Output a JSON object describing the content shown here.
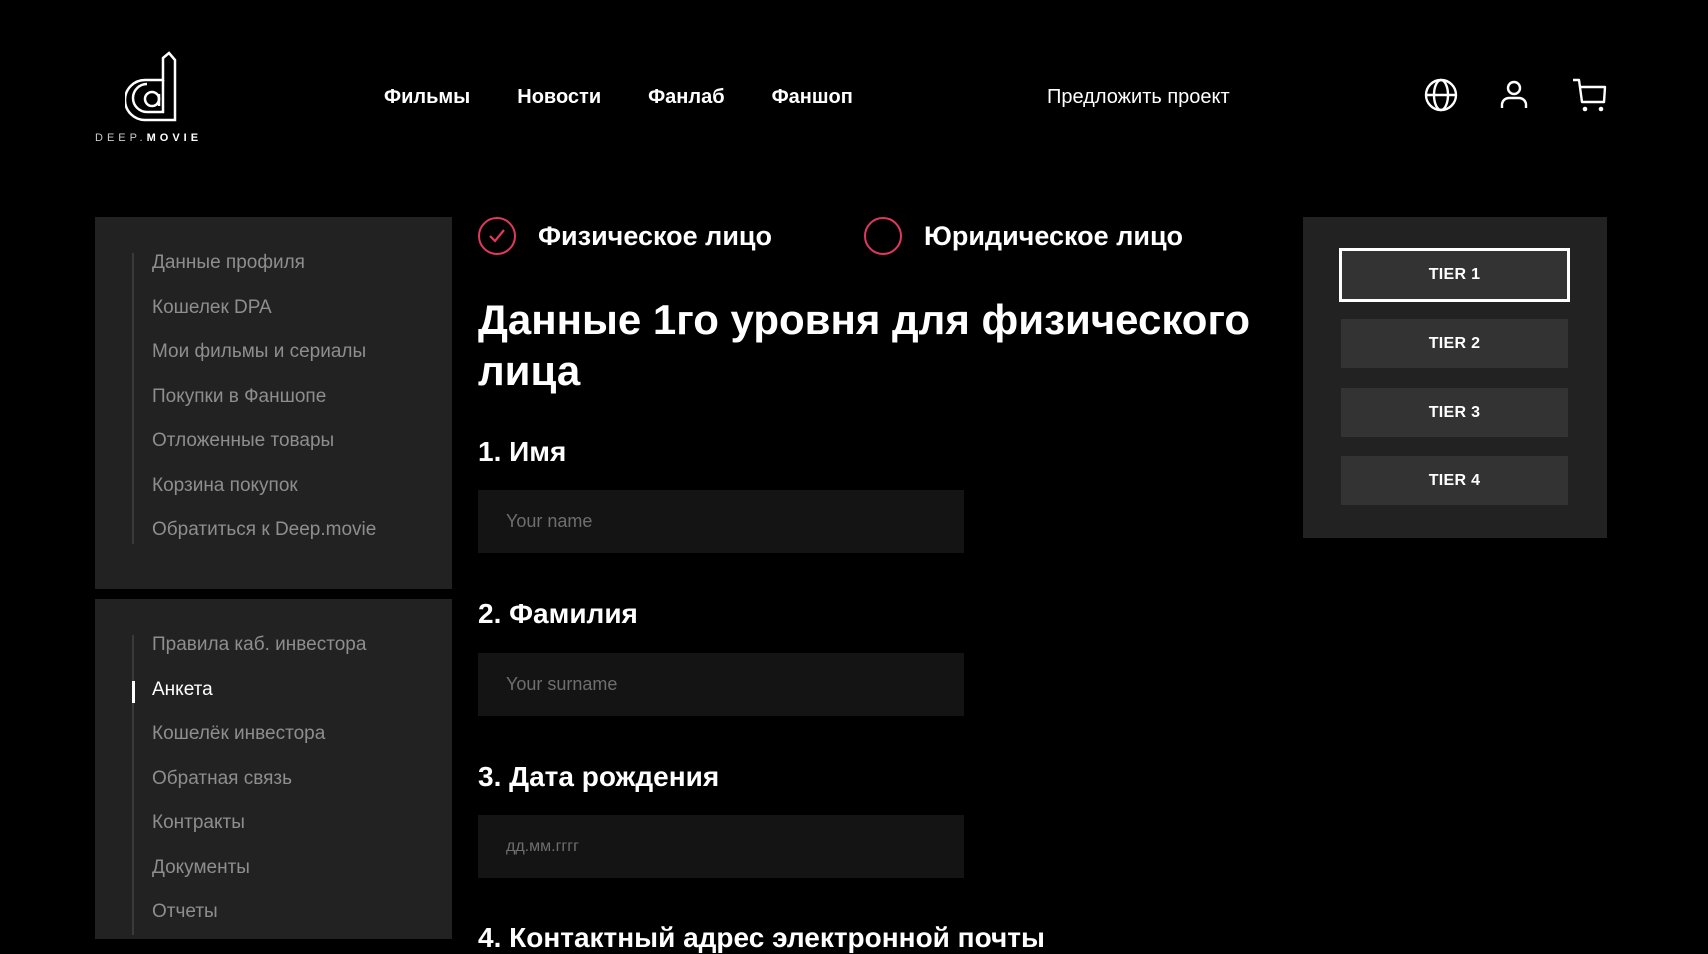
{
  "brand": {
    "name_light": "DEEP.",
    "name_bold": "MOVIE"
  },
  "nav": {
    "items": [
      "Фильмы",
      "Новости",
      "Фанлаб",
      "Фаншоп"
    ],
    "suggest_project": "Предложить проект"
  },
  "header_icons": [
    "globe-icon",
    "user-icon",
    "cart-icon"
  ],
  "sidebar": {
    "profile_menu": [
      "Данные профиля",
      "Кошелек DPA",
      "Мои фильмы и сериалы",
      "Покупки в Фаншопе",
      "Отложенные товары",
      "Корзина покупок",
      "Обратиться к Deep.movie"
    ],
    "investor_menu": [
      "Правила каб. инвестора",
      "Анкета",
      "Кошелёк инвестора",
      "Обратная связь",
      "Контракты",
      "Документы",
      "Отчеты"
    ],
    "active_item": "Анкета"
  },
  "person_type": {
    "options": [
      "Физическое лицо",
      "Юридическое лицо"
    ],
    "selected": "Физическое лицо"
  },
  "form": {
    "title": "Данные 1го уровня для физического лица",
    "fields": [
      {
        "label": "1. Имя",
        "placeholder": "Your name",
        "value": ""
      },
      {
        "label": "2. Фамилия",
        "placeholder": "Your surname",
        "value": ""
      },
      {
        "label": "3. Дата рождения",
        "placeholder": "дд.мм.гггг",
        "value": ""
      },
      {
        "label": "4. Контактный адрес электронной почты"
      }
    ]
  },
  "tiers": {
    "items": [
      "TIER 1",
      "TIER 2",
      "TIER 3",
      "TIER 4"
    ],
    "selected": "TIER 1"
  },
  "colors": {
    "accent": "#e0385e",
    "panel": "#222222",
    "input_bg": "#141414",
    "tier_bg": "#333333"
  }
}
